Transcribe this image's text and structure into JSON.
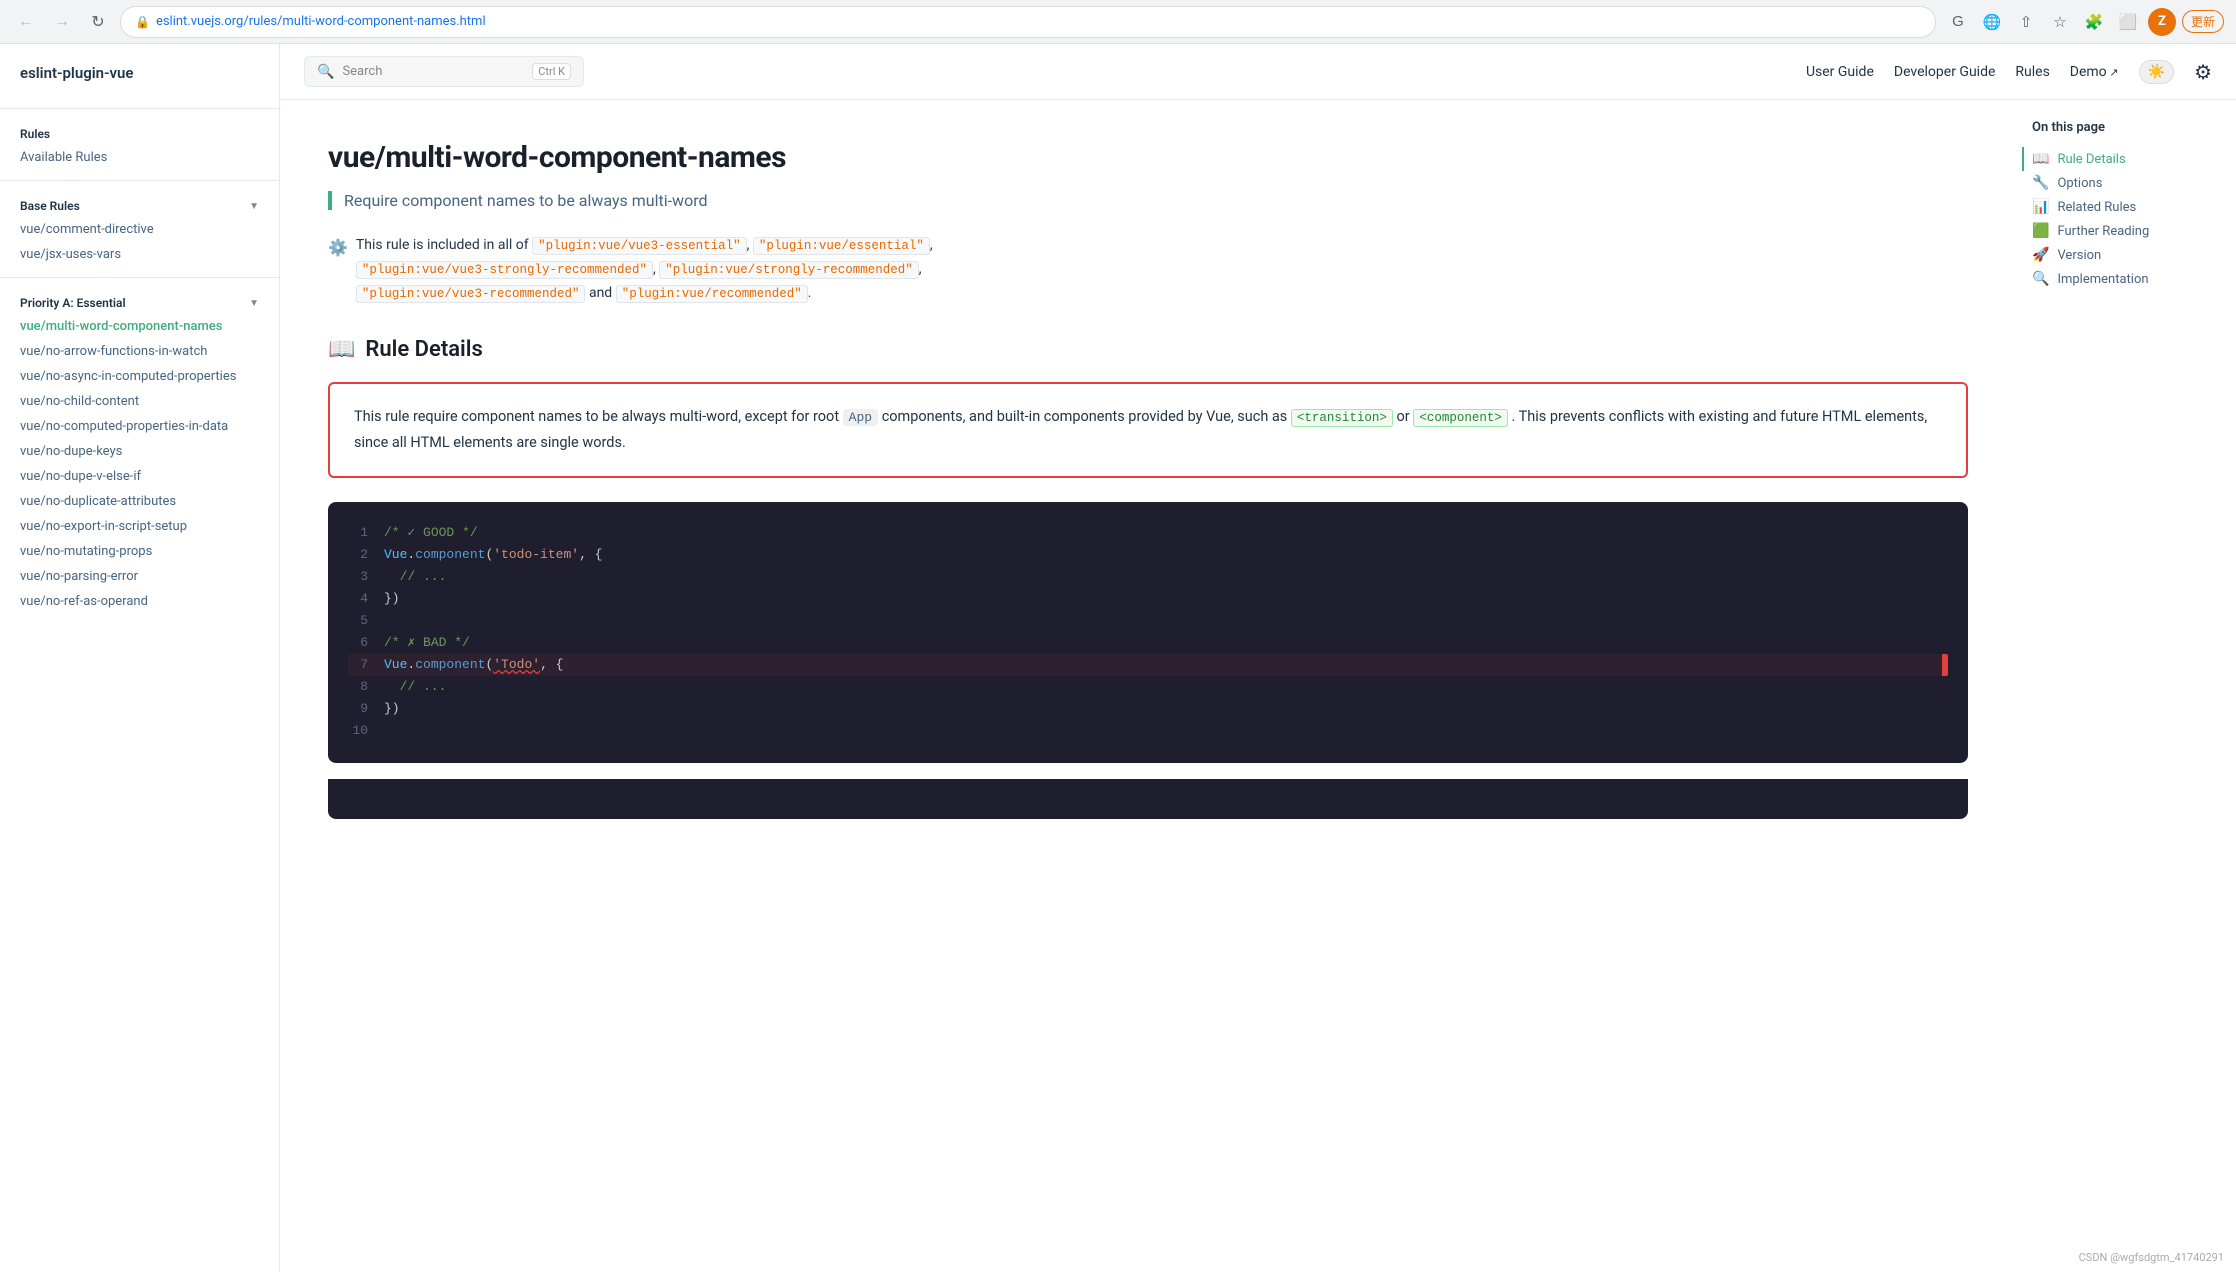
{
  "browser": {
    "url": "eslint.vuejs.org/rules/multi-word-component-names.html",
    "back_disabled": true,
    "forward_disabled": true,
    "profile_letter": "Z",
    "update_label": "更新"
  },
  "topnav": {
    "search_placeholder": "Search",
    "search_shortcut": "Ctrl K",
    "links": [
      {
        "label": "User Guide",
        "arrow": false
      },
      {
        "label": "Developer Guide",
        "arrow": false
      },
      {
        "label": "Rules",
        "arrow": false
      },
      {
        "label": "Demo",
        "arrow": true
      }
    ]
  },
  "sidebar": {
    "logo": "eslint-plugin-vue",
    "sections": [
      {
        "title": "Rules",
        "items": [
          {
            "label": "Available Rules",
            "active": false
          }
        ]
      },
      {
        "title": "Base Rules",
        "collapsible": true,
        "items": [
          {
            "label": "vue/comment-directive",
            "active": false
          },
          {
            "label": "vue/jsx-uses-vars",
            "active": false
          }
        ]
      },
      {
        "title": "Priority A: Essential",
        "collapsible": true,
        "items": [
          {
            "label": "vue/multi-word-component-names",
            "active": true
          },
          {
            "label": "vue/no-arrow-functions-in-watch",
            "active": false
          },
          {
            "label": "vue/no-async-in-computed-properties",
            "active": false
          },
          {
            "label": "vue/no-child-content",
            "active": false
          },
          {
            "label": "vue/no-computed-properties-in-data",
            "active": false
          },
          {
            "label": "vue/no-dupe-keys",
            "active": false
          },
          {
            "label": "vue/no-dupe-v-else-if",
            "active": false
          },
          {
            "label": "vue/no-duplicate-attributes",
            "active": false
          },
          {
            "label": "vue/no-export-in-script-setup",
            "active": false
          },
          {
            "label": "vue/no-mutating-props",
            "active": false
          },
          {
            "label": "vue/no-parsing-error",
            "active": false
          },
          {
            "label": "vue/no-ref-as-operand",
            "active": false
          }
        ]
      }
    ]
  },
  "toc": {
    "title": "On this page",
    "items": [
      {
        "label": "Rule Details",
        "icon": "📖",
        "active": true
      },
      {
        "label": "Options",
        "icon": "🔧"
      },
      {
        "label": "Related Rules",
        "icon": "📊"
      },
      {
        "label": "Further Reading",
        "icon": "🟩"
      },
      {
        "label": "Version",
        "icon": "🚀"
      },
      {
        "label": "Implementation",
        "icon": "🔍"
      }
    ]
  },
  "page": {
    "title": "vue/multi-word-component-names",
    "subtitle": "Require component names to be always multi-word",
    "included_prefix": "This rule is included in all of",
    "included_tags": [
      "\"plugin:vue/vue3-essential\"",
      "\"plugin:vue/essential\"",
      "\"plugin:vue/vue3-strongly-recommended\"",
      "\"plugin:vue/strongly-recommended\"",
      "\"plugin:vue/vue3-recommended\"",
      "\"plugin:vue/recommended\""
    ],
    "included_suffix": "and",
    "rule_details_heading": "Rule Details",
    "rule_details_heading_icon": "📖",
    "rule_details_text1": "This rule require component names to be always multi-word, except for root",
    "rule_details_app": "App",
    "rule_details_text2": "components, and built-in components provided by Vue, such as",
    "rule_details_transition": "<transition>",
    "rule_details_text3": "or",
    "rule_details_component": "<component>",
    "rule_details_text4": ". This prevents conflicts with existing and future HTML elements, since all HTML elements are single words.",
    "code_block": {
      "lines": [
        {
          "num": 1,
          "tokens": [
            {
              "type": "comment",
              "text": "/* ✓ GOOD */"
            }
          ]
        },
        {
          "num": 2,
          "tokens": [
            {
              "type": "obj",
              "text": "Vue"
            },
            {
              "type": "punct",
              "text": "."
            },
            {
              "type": "keyword",
              "text": "component"
            },
            {
              "type": "punct",
              "text": "("
            },
            {
              "type": "string",
              "text": "'todo-item'"
            },
            {
              "type": "punct",
              "text": ", {"
            }
          ]
        },
        {
          "num": 3,
          "tokens": [
            {
              "type": "comment",
              "text": "  // ..."
            }
          ]
        },
        {
          "num": 4,
          "tokens": [
            {
              "type": "punct",
              "text": "})"
            }
          ]
        },
        {
          "num": 5,
          "tokens": []
        },
        {
          "num": 6,
          "tokens": [
            {
              "type": "comment",
              "text": "/* ✗ BAD */"
            }
          ]
        },
        {
          "num": 7,
          "tokens": [
            {
              "type": "obj",
              "text": "Vue"
            },
            {
              "type": "punct",
              "text": "."
            },
            {
              "type": "keyword",
              "text": "component"
            },
            {
              "type": "punct",
              "text": "("
            },
            {
              "type": "string",
              "text": "'Todo'"
            },
            {
              "type": "punct",
              "text": ", {"
            }
          ],
          "bad": true
        },
        {
          "num": 8,
          "tokens": [
            {
              "type": "comment",
              "text": "  // ..."
            }
          ]
        },
        {
          "num": 9,
          "tokens": [
            {
              "type": "punct",
              "text": "})"
            }
          ]
        },
        {
          "num": 10,
          "tokens": []
        }
      ]
    }
  },
  "footer": {
    "watermark": "CSDN @wgfsdgtm_41740291"
  }
}
